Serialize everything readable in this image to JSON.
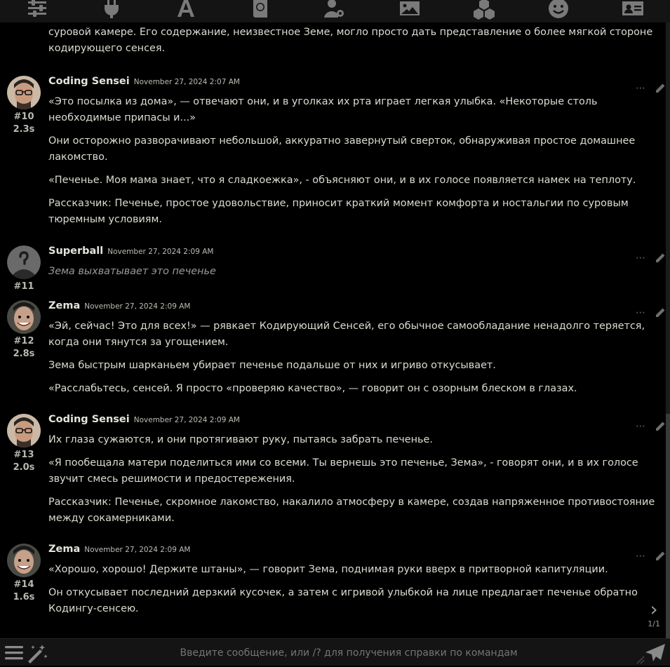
{
  "topbar": {
    "icons": [
      "sliders-icon",
      "plug-icon",
      "font-icon",
      "book-globe-icon",
      "user-gear-icon",
      "image-icon",
      "cubes-icon",
      "smile-icon",
      "id-card-icon"
    ]
  },
  "chat": {
    "partial_top": "Рассказчик: Аккуратно завернутый в тщательно упакованный пакет кажется маленьким актом доброты и уюта в суровой камере. Его содержание, неизвестное Земе, могло просто дать представление о более мягкой стороне кодирующего сенсея.",
    "messages": [
      {
        "id": "#10",
        "timer": "2.3s",
        "name": "Coding Sensei",
        "date": "November 27, 2024 2:07 AM",
        "paragraphs": [
          "«Это посылка из дома», — отвечают они, и в уголках их рта играет легкая улыбка. «Некоторые столь необходимые припасы и...»",
          "Они осторожно разворачивают небольшой, аккуратно завернутый сверток, обнаруживая простое домашнее лакомство.",
          "«Печенье. Моя мама знает, что я сладкоежка», - объясняют они, и в их голосе появляется намек на теплоту.",
          "Рассказчик: Печенье, простое удовольствие, приносит краткий момент комфорта и ностальгии по суровым тюремным условиям."
        ]
      },
      {
        "id": "#11",
        "timer": "",
        "name": "Superball",
        "date": "November 27, 2024 2:09 AM",
        "paragraphs": [
          "Зема выхватывает это печенье"
        ]
      },
      {
        "id": "#12",
        "timer": "2.8s",
        "name": "Zema",
        "date": "November 27, 2024 2:09 AM",
        "paragraphs": [
          "«Эй, сейчас! Это для всех!» — рявкает Кодирующий Сенсей, его обычное самообладание ненадолго теряется, когда они тянутся за угощением.",
          "Зема быстрым шарканьем убирает печенье подальше от них и игриво откусывает.",
          "«Расслабьтесь, сенсей. Я просто «проверяю качество», — говорит он с озорным блеском в глазах."
        ]
      },
      {
        "id": "#13",
        "timer": "2.0s",
        "name": "Coding Sensei",
        "date": "November 27, 2024 2:09 AM",
        "paragraphs": [
          "Их глаза сужаются, и они протягивают руку, пытаясь забрать печенье.",
          "«Я пообещала матери поделиться ими со всеми. Ты вернешь это печенье, Зема», - говорят они, и в их голосе звучит смесь решимости и предостережения.",
          "Рассказчик: Печенье, скромное лакомство, накалило атмосферу в камере, создав напряженное противостояние между сокамерниками."
        ]
      },
      {
        "id": "#14",
        "timer": "1.6s",
        "name": "Zema",
        "date": "November 27, 2024 2:09 AM",
        "paragraphs": [
          "«Хорошо, хорошо! Держите штаны», — говорит Зема, поднимая руки вверх в притворной капитуляции.",
          "Он откусывает последний дерзкий кусочек, а затем с игривой улыбкой на лице предлагает печенье обратно Кодингу-сенсею."
        ]
      }
    ],
    "actions": {
      "more": "⋯"
    },
    "pager": {
      "chevron": "›",
      "count": "1/1"
    }
  },
  "input": {
    "placeholder": "Введите сообщение, или /? для получения справки по командам"
  },
  "colors": {
    "background": "#000000",
    "bar": "#141414",
    "text": "#dcdcd2",
    "muted": "#9a9a94"
  }
}
